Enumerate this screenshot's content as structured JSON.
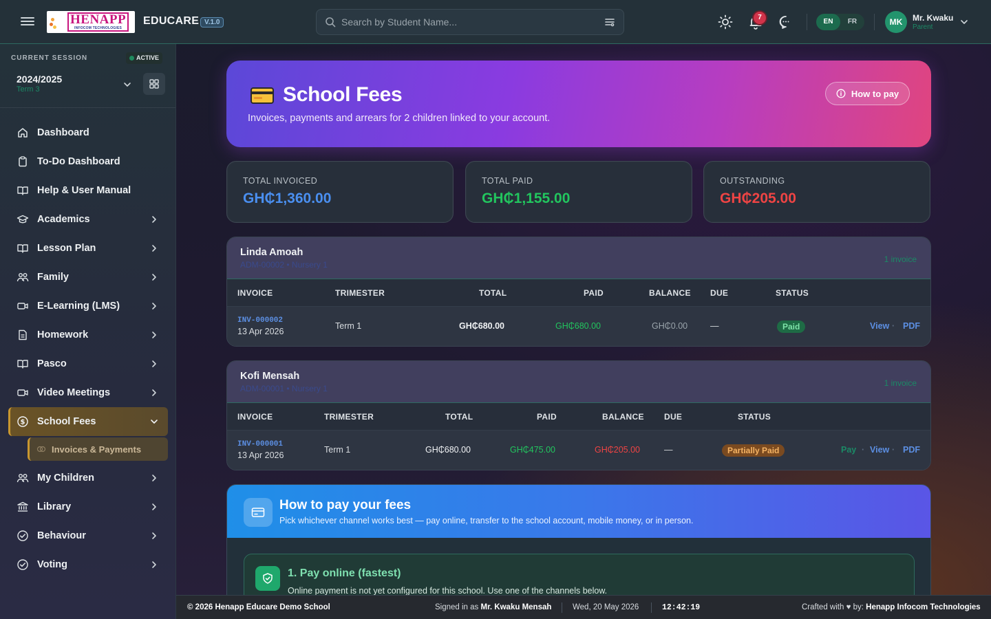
{
  "topbar": {
    "logo_main": "HENAPP",
    "logo_sub": "INFOCOM TECHNOLOGIES",
    "brand": "EDUCARE",
    "version": "V.1.0",
    "search_placeholder": "Search by Student Name...",
    "notifications_count": "7",
    "lang_en": "EN",
    "lang_fr": "FR",
    "avatar_initials": "MK",
    "user_name": "Mr. Kwaku",
    "user_role": "Parent"
  },
  "session": {
    "label": "CURRENT SESSION",
    "status": "ACTIVE",
    "year": "2024/2025",
    "term": "Term 3"
  },
  "sidebar": {
    "items": [
      {
        "label": "Dashboard",
        "icon": "home-icon"
      },
      {
        "label": "To-Do Dashboard",
        "icon": "clipboard-icon"
      },
      {
        "label": "Help & User Manual",
        "icon": "book-icon"
      },
      {
        "label": "Academics",
        "icon": "graduation-icon"
      },
      {
        "label": "Lesson Plan",
        "icon": "book-icon"
      },
      {
        "label": "Family",
        "icon": "users-icon"
      },
      {
        "label": "E-Learning (LMS)",
        "icon": "video-icon"
      },
      {
        "label": "Homework",
        "icon": "file-icon"
      },
      {
        "label": "Pasco",
        "icon": "book-icon"
      },
      {
        "label": "Video Meetings",
        "icon": "video-icon"
      },
      {
        "label": "School Fees",
        "icon": "dollar-icon"
      },
      {
        "label": "My Children",
        "icon": "users-icon"
      },
      {
        "label": "Library",
        "icon": "library-icon"
      },
      {
        "label": "Behaviour",
        "icon": "check-circle-icon"
      },
      {
        "label": "Voting",
        "icon": "check-circle-icon"
      }
    ],
    "sub_item": "Invoices & Payments"
  },
  "hero": {
    "title": "School Fees",
    "subtitle": "Invoices, payments and arrears for 2 children linked to your account.",
    "button": "How to pay"
  },
  "stats": {
    "invoiced_label": "TOTAL INVOICED",
    "invoiced_value": "GH₵1,360.00",
    "paid_label": "TOTAL PAID",
    "paid_value": "GH₵1,155.00",
    "outstanding_label": "OUTSTANDING",
    "outstanding_value": "GH₵205.00"
  },
  "columns": {
    "invoice": "INVOICE",
    "trimester": "TRIMESTER",
    "total": "TOTAL",
    "paid": "PAID",
    "balance": "BALANCE",
    "due": "DUE",
    "status": "STATUS"
  },
  "children": [
    {
      "name": "Linda Amoah",
      "meta": "ADM-00002 • Nursery 1",
      "count": "1 invoice",
      "invoice_no": "INV-000002",
      "date": "13 Apr 2026",
      "trimester": "Term 1",
      "total": "GH₵680.00",
      "paid": "GH₵680.00",
      "balance": "GH₵0.00",
      "due": "—",
      "status": "Paid",
      "view": "View",
      "pdf": "PDF"
    },
    {
      "name": "Kofi Mensah",
      "meta": "ADM-00001 • Nursery 1",
      "count": "1 invoice",
      "invoice_no": "INV-000001",
      "date": "13 Apr 2026",
      "trimester": "Term 1",
      "total": "GH₵680.00",
      "paid": "GH₵475.00",
      "balance": "GH₵205.00",
      "due": "—",
      "status": "Partially Paid",
      "pay": "Pay",
      "view": "View",
      "pdf": "PDF"
    }
  ],
  "howpay": {
    "title": "How to pay your fees",
    "subtitle": "Pick whichever channel works best — pay online, transfer to the school account, mobile money, or in person.",
    "option1_title": "1. Pay online (fastest)",
    "option1_text": "Online payment is not yet configured for this school. Use one of the channels below."
  },
  "footer": {
    "copyright": "© 2026 Henapp Educare Demo School",
    "signed_prefix": "Signed in as",
    "signed_user": "Mr. Kwaku Mensah",
    "date": "Wed, 20 May 2026",
    "time": "12:42:19",
    "crafted_prefix": "Crafted with",
    "crafted_by": "by:",
    "crafted_company": "Henapp Infocom Technologies"
  },
  "colors": {
    "accent_green": "#1b8a66",
    "invoiced_blue": "#4a8ff0",
    "paid_green": "#22c55e",
    "outstanding_red": "#ef4444"
  }
}
